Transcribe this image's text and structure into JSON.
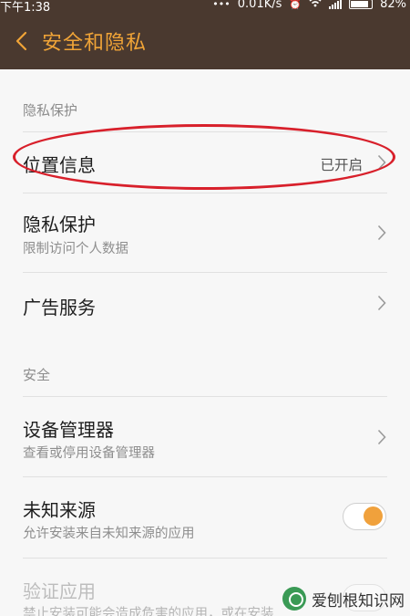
{
  "status_bar": {
    "time": "下午1:38",
    "net_speed": "0.01K/s",
    "battery": "82%"
  },
  "header": {
    "title": "安全和隐私"
  },
  "sections": [
    {
      "header": "隐私保护",
      "items": [
        {
          "title": "位置信息",
          "value": "已开启"
        },
        {
          "title": "隐私保护",
          "subtitle": "限制访问个人数据"
        },
        {
          "title": "广告服务"
        }
      ]
    },
    {
      "header": "安全",
      "items": [
        {
          "title": "设备管理器",
          "subtitle": "查看或停用设备管理器"
        },
        {
          "title": "未知来源",
          "subtitle": "允许安装来自未知来源的应用",
          "toggle_on": true
        },
        {
          "title": "验证应用",
          "subtitle": "禁止安装可能会造成危害的应用，或在安装"
        }
      ]
    }
  ],
  "watermark": {
    "text": "爱刨根知识网"
  },
  "colors": {
    "accent": "#f0a437",
    "header_bg": "#4a392f",
    "highlight": "#d8202b"
  }
}
